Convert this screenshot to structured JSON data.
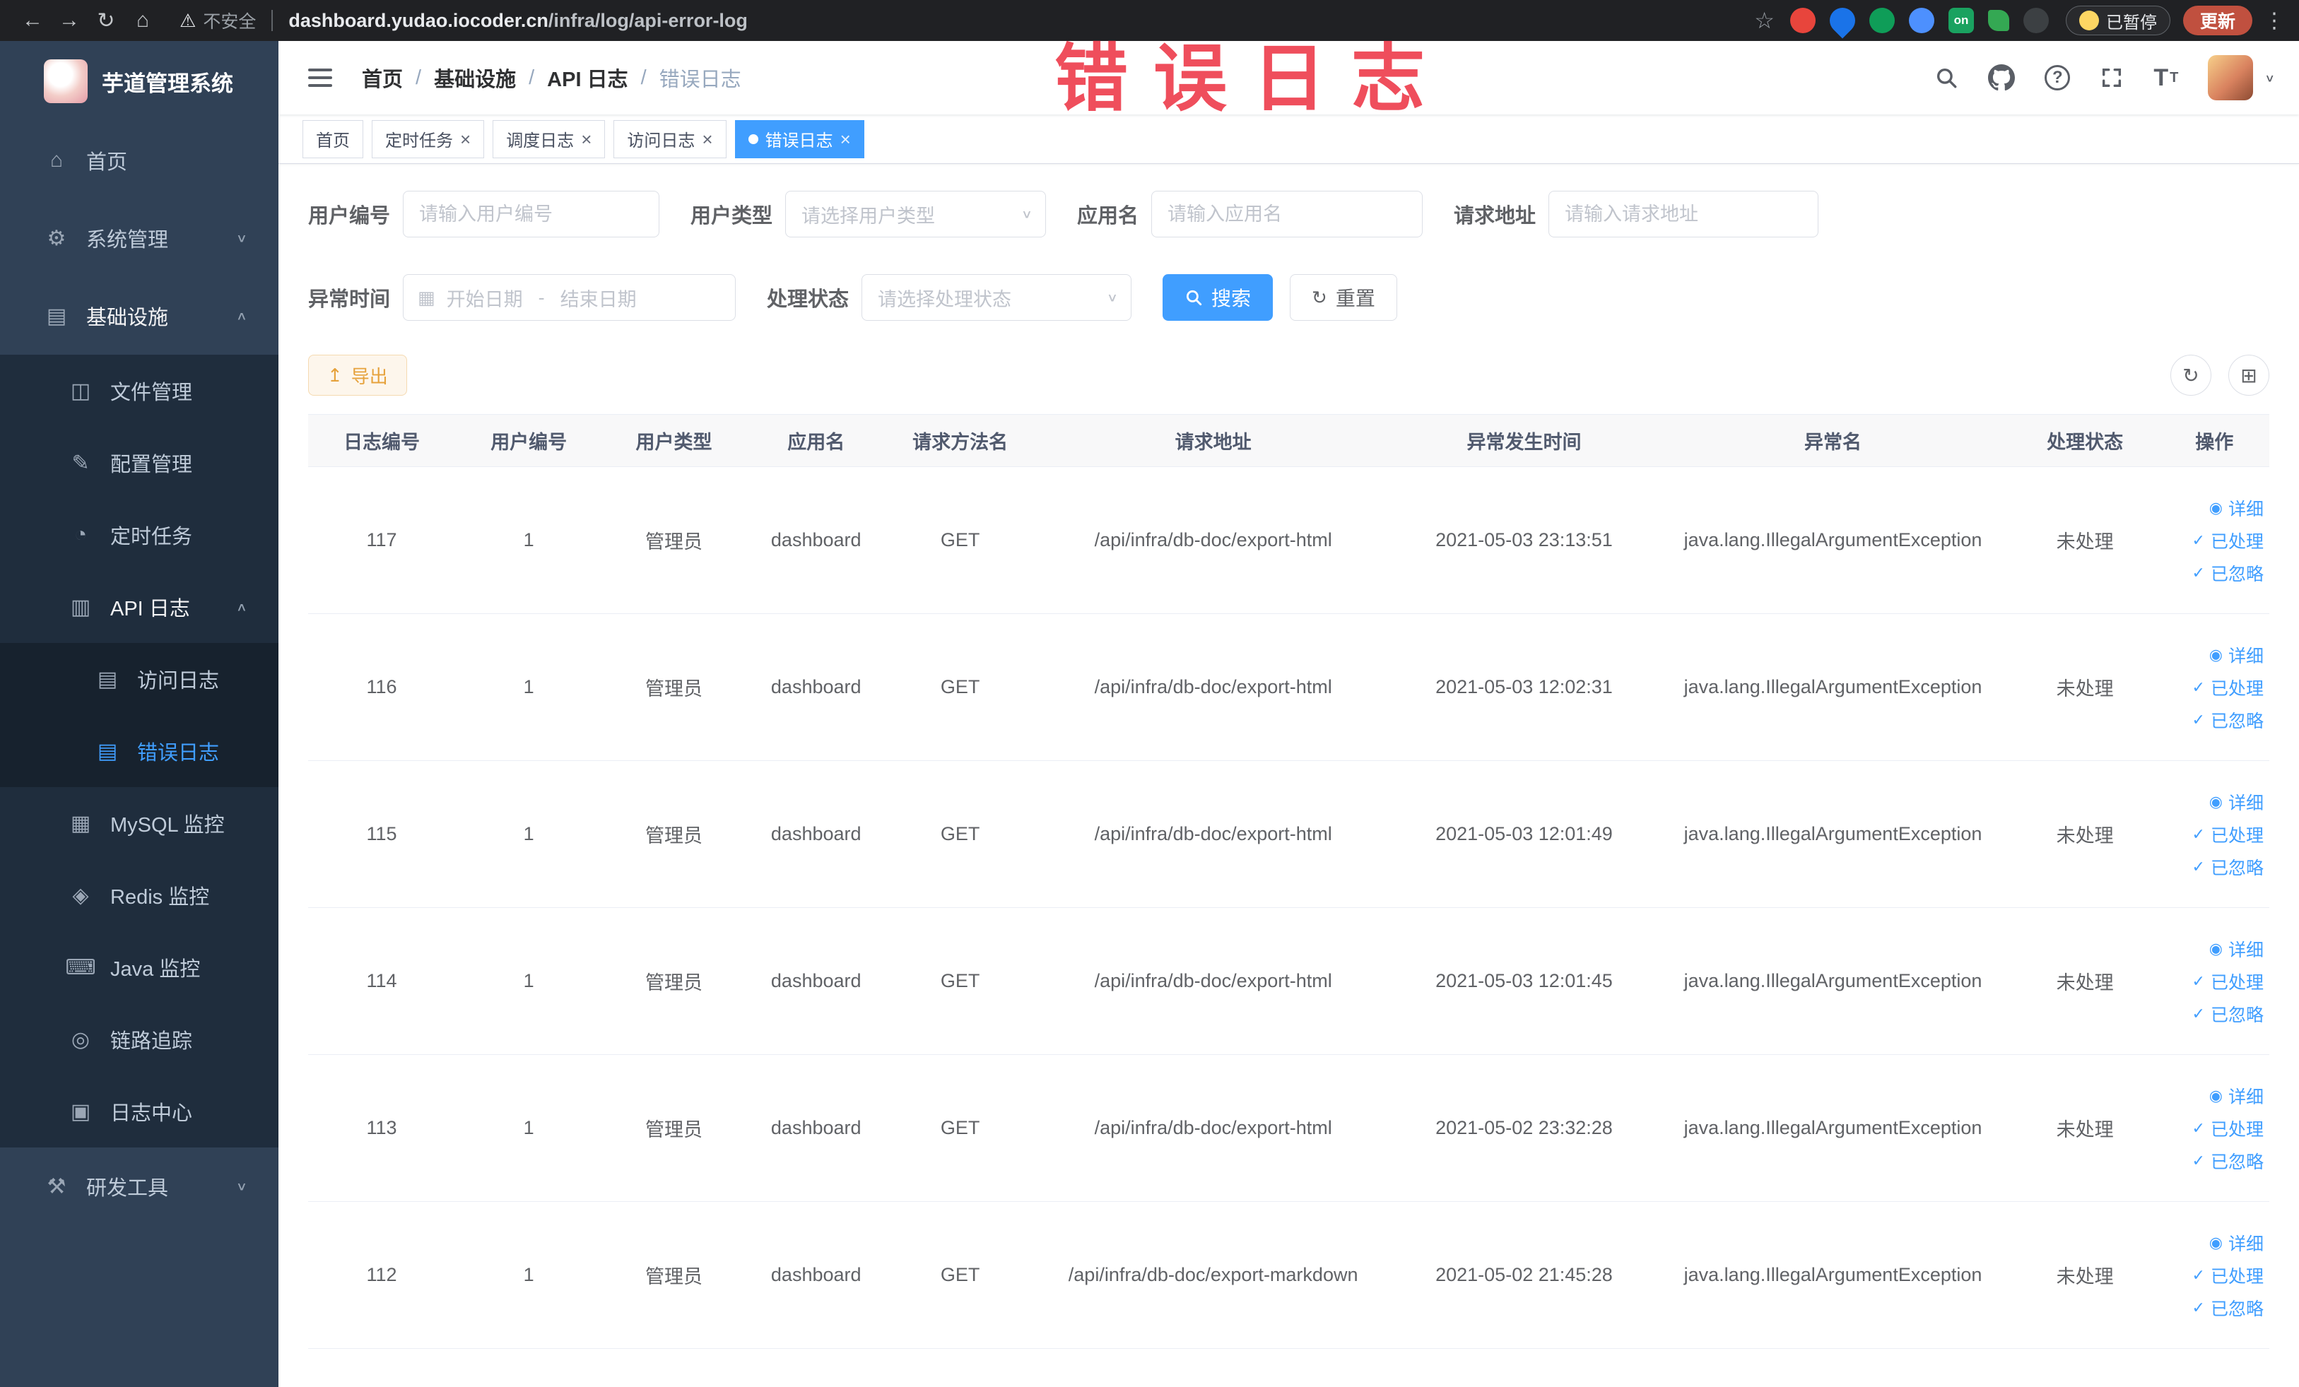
{
  "colors": {
    "accent": "#409EFF",
    "warning": "#e6a23c",
    "annotation_red": "#ee3f4f",
    "sidebar_bg": "#304156"
  },
  "annotation": {
    "text": "错误日志"
  },
  "browser": {
    "security_label": "不安全",
    "url_domain": "dashboard.yudao.iocoder.cn",
    "url_path": "/infra/log/api-error-log",
    "paused_label": "已暂停",
    "update_label": "更新",
    "extensions": [
      {
        "name": "adblock-icon",
        "label": ""
      },
      {
        "name": "drop-icon",
        "label": ""
      },
      {
        "name": "video-icon",
        "label": ""
      },
      {
        "name": "grid-icon",
        "label": ""
      },
      {
        "name": "onetab-icon",
        "label": "on"
      },
      {
        "name": "leaf-icon",
        "label": ""
      },
      {
        "name": "pin-icon",
        "label": ""
      }
    ]
  },
  "sidebar": {
    "title": "芋道管理系统",
    "items": [
      {
        "id": "home",
        "label": "首页",
        "icon": "home-icon",
        "level": 1
      },
      {
        "id": "system",
        "label": "系统管理",
        "icon": "gear-icon",
        "level": 1,
        "chevron": "down"
      },
      {
        "id": "infra",
        "label": "基础设施",
        "icon": "infra-icon",
        "level": 1,
        "chevron": "up",
        "open": true
      },
      {
        "id": "file",
        "label": "文件管理",
        "icon": "file-icon",
        "level": 2
      },
      {
        "id": "config",
        "label": "配置管理",
        "icon": "config-icon",
        "level": 2
      },
      {
        "id": "cron",
        "label": "定时任务",
        "icon": "cron-icon",
        "level": 2
      },
      {
        "id": "api-log",
        "label": "API 日志",
        "icon": "api-log-icon",
        "level": 2,
        "chevron": "up",
        "open": true
      },
      {
        "id": "access-log",
        "label": "访问日志",
        "icon": "access-log-icon",
        "level": 3
      },
      {
        "id": "error-log",
        "label": "错误日志",
        "icon": "error-log-icon",
        "level": 3,
        "active": true
      },
      {
        "id": "mysql",
        "label": "MySQL 监控",
        "icon": "mysql-icon",
        "level": 2
      },
      {
        "id": "redis",
        "label": "Redis 监控",
        "icon": "redis-icon",
        "level": 2
      },
      {
        "id": "java",
        "label": "Java 监控",
        "icon": "java-icon",
        "level": 2
      },
      {
        "id": "trace",
        "label": "链路追踪",
        "icon": "trace-icon",
        "level": 2
      },
      {
        "id": "log-center",
        "label": "日志中心",
        "icon": "log-center-icon",
        "level": 2
      },
      {
        "id": "devtools",
        "label": "研发工具",
        "icon": "devtools-icon",
        "level": 1,
        "chevron": "down"
      }
    ]
  },
  "header": {
    "breadcrumb": [
      "首页",
      "基础设施",
      "API 日志",
      "错误日志"
    ]
  },
  "tabs": [
    {
      "id": "home",
      "label": "首页",
      "closable": false,
      "active": false
    },
    {
      "id": "cron",
      "label": "定时任务",
      "closable": true,
      "active": false
    },
    {
      "id": "schedule-log",
      "label": "调度日志",
      "closable": true,
      "active": false
    },
    {
      "id": "access-log",
      "label": "访问日志",
      "closable": true,
      "active": false
    },
    {
      "id": "error-log",
      "label": "错误日志",
      "closable": true,
      "active": true
    }
  ],
  "filters": {
    "user_id": {
      "label": "用户编号",
      "placeholder": "请输入用户编号"
    },
    "user_type": {
      "label": "用户类型",
      "placeholder": "请选择用户类型"
    },
    "app_name": {
      "label": "应用名",
      "placeholder": "请输入应用名"
    },
    "request_url": {
      "label": "请求地址",
      "placeholder": "请输入请求地址"
    },
    "exception_time": {
      "label": "异常时间",
      "start_placeholder": "开始日期",
      "separator": "-",
      "end_placeholder": "结束日期"
    },
    "process_status": {
      "label": "处理状态",
      "placeholder": "请选择处理状态"
    },
    "search_label": "搜索",
    "reset_label": "重置"
  },
  "toolbar": {
    "export_label": "导出"
  },
  "table": {
    "columns": [
      {
        "key": "id",
        "label": "日志编号",
        "width": "7.5%"
      },
      {
        "key": "user_id",
        "label": "用户编号",
        "width": "7.5%"
      },
      {
        "key": "user_type",
        "label": "用户类型",
        "width": "7.3%"
      },
      {
        "key": "app",
        "label": "应用名",
        "width": "7.2%"
      },
      {
        "key": "method",
        "label": "请求方法名",
        "width": "7.5%"
      },
      {
        "key": "url",
        "label": "请求地址",
        "width": "18.3%"
      },
      {
        "key": "time",
        "label": "异常发生时间",
        "width": "13.4%"
      },
      {
        "key": "exception",
        "label": "异常名",
        "width": "18.1%"
      },
      {
        "key": "status",
        "label": "处理状态",
        "width": "7.6%"
      },
      {
        "key": "actions",
        "label": "操作",
        "width": "5.6%"
      }
    ],
    "rows": [
      {
        "id": "117",
        "user_id": "1",
        "user_type": "管理员",
        "app": "dashboard",
        "method": "GET",
        "url": "/api/infra/db-doc/export-html",
        "time": "2021-05-03 23:13:51",
        "exception": "java.lang.IllegalArgumentException",
        "status": "未处理"
      },
      {
        "id": "116",
        "user_id": "1",
        "user_type": "管理员",
        "app": "dashboard",
        "method": "GET",
        "url": "/api/infra/db-doc/export-html",
        "time": "2021-05-03 12:02:31",
        "exception": "java.lang.IllegalArgumentException",
        "status": "未处理"
      },
      {
        "id": "115",
        "user_id": "1",
        "user_type": "管理员",
        "app": "dashboard",
        "method": "GET",
        "url": "/api/infra/db-doc/export-html",
        "time": "2021-05-03 12:01:49",
        "exception": "java.lang.IllegalArgumentException",
        "status": "未处理"
      },
      {
        "id": "114",
        "user_id": "1",
        "user_type": "管理员",
        "app": "dashboard",
        "method": "GET",
        "url": "/api/infra/db-doc/export-html",
        "time": "2021-05-03 12:01:45",
        "exception": "java.lang.IllegalArgumentException",
        "status": "未处理"
      },
      {
        "id": "113",
        "user_id": "1",
        "user_type": "管理员",
        "app": "dashboard",
        "method": "GET",
        "url": "/api/infra/db-doc/export-html",
        "time": "2021-05-02 23:32:28",
        "exception": "java.lang.IllegalArgumentException",
        "status": "未处理"
      },
      {
        "id": "112",
        "user_id": "1",
        "user_type": "管理员",
        "app": "dashboard",
        "method": "GET",
        "url": "/api/infra/db-doc/export-markdown",
        "time": "2021-05-02 21:45:28",
        "exception": "java.lang.IllegalArgumentException",
        "status": "未处理"
      }
    ],
    "actions": [
      {
        "id": "detail",
        "label": "详细",
        "icon": "eye-icon"
      },
      {
        "id": "processed",
        "label": "已处理",
        "icon": "check-icon"
      },
      {
        "id": "ignored",
        "label": "已忽略",
        "icon": "check-icon"
      }
    ]
  },
  "icons": {
    "home-icon": "⌂",
    "gear-icon": "⚙",
    "infra-icon": "▤",
    "file-icon": "◫",
    "config-icon": "✎",
    "cron-icon": "◔",
    "api-log-icon": "▥",
    "access-log-icon": "▤",
    "error-log-icon": "▤",
    "mysql-icon": "▦",
    "redis-icon": "◈",
    "java-icon": "⌨",
    "trace-icon": "◎",
    "log-center-icon": "▣",
    "devtools-icon": "⚒",
    "eye-icon": "◉",
    "check-icon": "✓",
    "upload-icon": "↥",
    "refresh-icon": "↻",
    "grid-icon": "⊞",
    "calendar-icon": "▦",
    "caret-icon": "∨",
    "back-icon": "←",
    "forward-icon": "→",
    "reload-icon": "↻",
    "home-glyph-icon": "⌂",
    "star-icon": "☆",
    "kebab-icon": "⋮",
    "warning-icon": "⚠",
    "question-icon": "?",
    "font-size-icon": "T"
  }
}
